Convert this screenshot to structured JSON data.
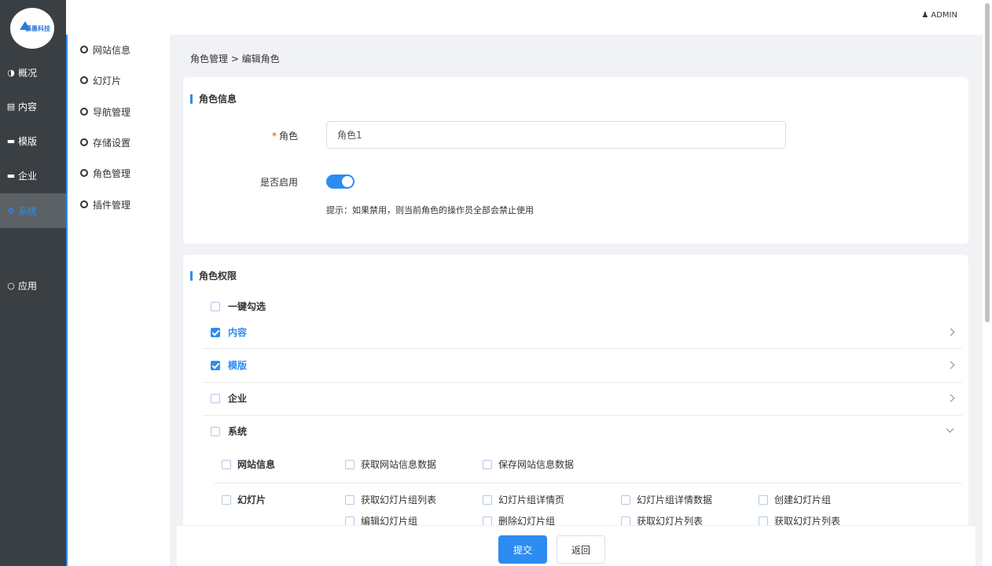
{
  "header": {
    "user": "ADMIN"
  },
  "brand": {
    "logo_text": "慕墨科技"
  },
  "sidebar": {
    "items": [
      {
        "label": "概况",
        "icon": "dashboard-icon"
      },
      {
        "label": "内容",
        "icon": "document-icon"
      },
      {
        "label": "模版",
        "icon": "folder-icon"
      },
      {
        "label": "企业",
        "icon": "folder-icon"
      },
      {
        "label": "系统",
        "icon": "gear-icon",
        "active": true
      },
      {
        "label": "应用",
        "icon": "circle-icon"
      }
    ]
  },
  "submenu": {
    "items": [
      "网站信息",
      "幻灯片",
      "导航管理",
      "存储设置",
      "角色管理",
      "插件管理"
    ]
  },
  "breadcrumb": "角色管理 > 编辑角色",
  "role_info": {
    "title": "角色信息",
    "role_label": "角色",
    "role_value": "角色1",
    "enabled_label": "是否启用",
    "enabled": true,
    "hint": "提示：如果禁用，则当前角色的操作员全部会禁止使用"
  },
  "permissions": {
    "title": "角色权限",
    "select_all": "一键勾选",
    "groups": [
      {
        "label": "内容",
        "checked": true
      },
      {
        "label": "模版",
        "checked": true
      },
      {
        "label": "企业",
        "checked": false
      },
      {
        "label": "系统",
        "checked": false
      }
    ],
    "system_sub": {
      "website_info": {
        "label": "网站信息",
        "actions": [
          "获取网站信息数据",
          "保存网站信息数据"
        ]
      },
      "slides": {
        "label": "幻灯片",
        "actions": [
          "获取幻灯片组列表",
          "幻灯片组详情页",
          "幻灯片组详情数据",
          "创建幻灯片组",
          "编辑幻灯片组",
          "删除幻灯片组",
          "获取幻灯片列表",
          "获取幻灯片列表"
        ]
      }
    }
  },
  "footer": {
    "submit": "提交",
    "back": "返回"
  },
  "colors": {
    "accent": "#2d8cf0",
    "sidebar_bg": "#3a3f44"
  }
}
